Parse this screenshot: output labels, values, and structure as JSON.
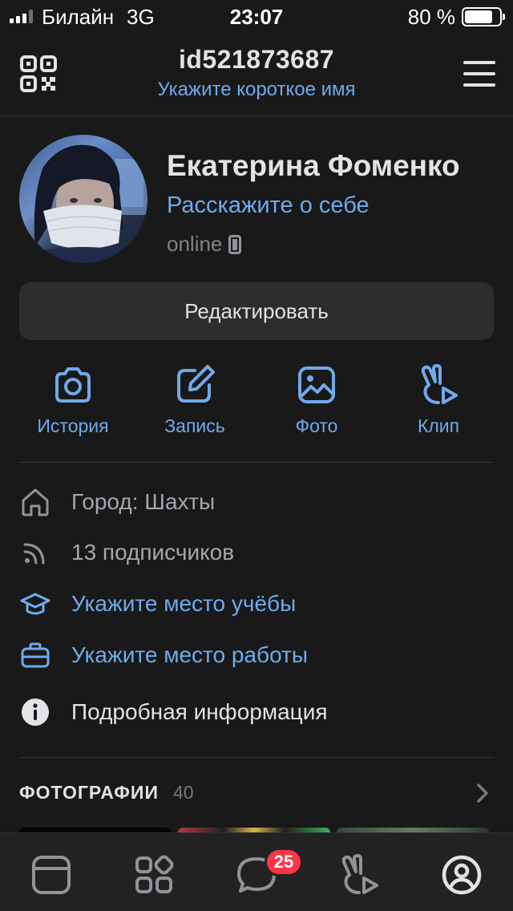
{
  "status_bar": {
    "carrier": "Билайн",
    "network": "3G",
    "time": "23:07",
    "battery": "80 %",
    "battery_level": 0.8
  },
  "header": {
    "title": "id521873687",
    "subtitle": "Укажите короткое имя",
    "qr_icon": "qr-code-icon",
    "menu_icon": "hamburger-menu-icon"
  },
  "profile": {
    "name": "Екатерина Фоменко",
    "about": "Расскажите о себе",
    "status": "online",
    "status_icon": "mobile-phone-icon",
    "edit_label": "Редактировать"
  },
  "actions": [
    {
      "label": "История",
      "icon": "camera-icon"
    },
    {
      "label": "Запись",
      "icon": "edit-icon"
    },
    {
      "label": "Фото",
      "icon": "image-icon"
    },
    {
      "label": "Клип",
      "icon": "clip-icon"
    }
  ],
  "info": {
    "city": "Город: Шахты",
    "followers": "13 подписчиков",
    "education": "Укажите место учёбы",
    "work": "Укажите место работы",
    "details": "Подробная информация"
  },
  "photos": {
    "title": "ФОТОГРАФИИ",
    "count": "40"
  },
  "tabbar": {
    "items": [
      "feed-icon",
      "services-icon",
      "messages-icon",
      "clips-icon",
      "profile-icon"
    ],
    "messages_badge": "25"
  },
  "colors": {
    "background": "#19191a",
    "accent": "#71aaeb",
    "badge": "#ff3347",
    "text_primary": "#e1e3e6",
    "text_secondary": "#a4a7ad"
  }
}
